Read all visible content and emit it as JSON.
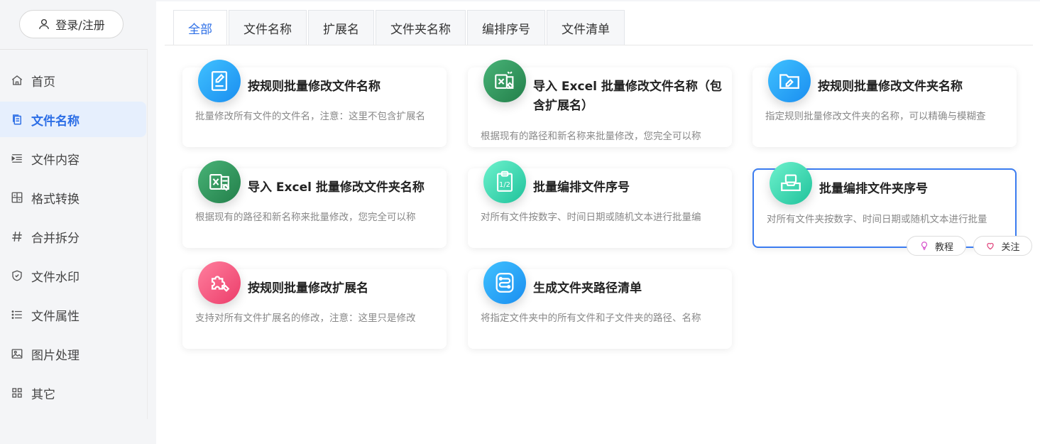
{
  "auth": {
    "login_label": "登录/注册"
  },
  "sidebar": {
    "items": [
      {
        "label": "首页",
        "icon": "home-icon"
      },
      {
        "label": "文件名称",
        "icon": "file-copy-icon",
        "active": true
      },
      {
        "label": "文件内容",
        "icon": "indent-list-icon"
      },
      {
        "label": "格式转换",
        "icon": "grid-convert-icon"
      },
      {
        "label": "合并拆分",
        "icon": "hash-icon"
      },
      {
        "label": "文件水印",
        "icon": "shield-icon"
      },
      {
        "label": "文件属性",
        "icon": "list-icon"
      },
      {
        "label": "图片处理",
        "icon": "image-icon"
      },
      {
        "label": "其它",
        "icon": "apps-icon"
      }
    ]
  },
  "tabs": [
    {
      "label": "全部",
      "active": true
    },
    {
      "label": "文件名称"
    },
    {
      "label": "扩展名"
    },
    {
      "label": "文件夹名称"
    },
    {
      "label": "编排序号"
    },
    {
      "label": "文件清单"
    }
  ],
  "cards": [
    {
      "title": "按规则批量修改文件名称",
      "desc": "批量修改所有文件的文件名，注意：这里不包含扩展名",
      "icon": "edit-document-icon",
      "color": "#2d9cf5"
    },
    {
      "title": "导入 Excel 批量修改文件名称（包含扩展名）",
      "desc": "根据现有的路径和新名称来批量修改，您完全可以称",
      "icon": "excel-icon",
      "color": "#2e9a5d"
    },
    {
      "title": "按规则批量修改文件夹名称",
      "desc": "指定规则批量修改文件夹的名称，可以精确与模糊查",
      "icon": "folder-edit-icon",
      "color": "#2d9cf5"
    },
    {
      "title": "导入 Excel 批量修改文件夹名称",
      "desc": "根据现有的路径和新名称来批量修改，您完全可以称",
      "icon": "excel-icon",
      "color": "#2e9a5d"
    },
    {
      "title": "批量编排文件序号",
      "desc": "对所有文件按数字、时间日期或随机文本进行批量编",
      "icon": "clipboard-number-icon",
      "color": "#34d3b0"
    },
    {
      "title": "批量编排文件夹序号",
      "desc": "对所有文件夹按数字、时间日期或随机文本进行批量",
      "icon": "inbox-icon",
      "color": "#34d3b0",
      "selected": true
    },
    {
      "title": "按规则批量修改扩展名",
      "desc": "支持对所有文件扩展名的修改，注意：这里只是修改",
      "icon": "puzzle-icon",
      "color": "#f2557a"
    },
    {
      "title": "生成文件夹路径清单",
      "desc": "将指定文件夹中的所有文件和子文件夹的路径、名称",
      "icon": "path-icon",
      "color": "#2d9cf5"
    }
  ],
  "actions": {
    "tutorial_label": "教程",
    "follow_label": "关注"
  },
  "colors": {
    "accent": "#2c6ee6",
    "active_bg": "#e6effd",
    "tutorial_icon": "#d64fcb",
    "follow_icon": "#e0407a"
  }
}
